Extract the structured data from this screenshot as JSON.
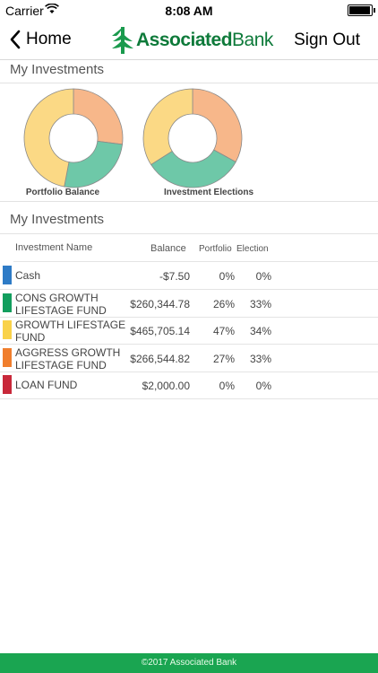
{
  "status_bar": {
    "carrier": "Carrier",
    "time": "8:08 AM",
    "battery_level": 0.95
  },
  "nav": {
    "back_label": "Home",
    "logo_text": "AssociatedBank",
    "logo_bold": "Associated",
    "logo_regular": "Bank",
    "sign_out_label": "Sign Out"
  },
  "section1_title": "My Investments",
  "section2_title": "My Investments",
  "charts": {
    "portfolio": {
      "label": "Portfolio Balance"
    },
    "elections": {
      "label": "Investment Elections"
    }
  },
  "colors": {
    "cash": "#2e7bc6",
    "cons": "#129e5e",
    "growth": "#f9d24a",
    "aggress": "#f07e2d",
    "loan": "#c8283a",
    "donut_orange": "#f7b78a",
    "donut_green": "#6ec8a8",
    "donut_yellow": "#fbd985",
    "footer_green": "#1aa551"
  },
  "table": {
    "headers": {
      "name": "Investment Name",
      "balance": "Balance",
      "portfolio": "Portfolio",
      "election": "Election"
    },
    "rows": [
      {
        "key": "cash",
        "line1": "Cash",
        "line2": "",
        "balance": "-$7.50",
        "portfolio": "0%",
        "election": "0%"
      },
      {
        "key": "cons",
        "line1": "CONS GROWTH",
        "line2": "LIFESTAGE FUND",
        "balance": "$260,344.78",
        "portfolio": "26%",
        "election": "33%"
      },
      {
        "key": "growth",
        "line1": "GROWTH LIFESTAGE",
        "line2": "FUND",
        "balance": "$465,705.14",
        "portfolio": "47%",
        "election": "34%"
      },
      {
        "key": "aggress",
        "line1": "AGGRESS GROWTH",
        "line2": "LIFESTAGE FUND",
        "balance": "$266,544.82",
        "portfolio": "27%",
        "election": "33%"
      },
      {
        "key": "loan",
        "line1": "LOAN FUND",
        "line2": "",
        "balance": "$2,000.00",
        "portfolio": "0%",
        "election": "0%"
      }
    ]
  },
  "chart_data": [
    {
      "type": "pie",
      "title": "Portfolio Balance",
      "categories": [
        "Cash",
        "CONS GROWTH LIFESTAGE FUND",
        "GROWTH LIFESTAGE FUND",
        "AGGRESS GROWTH LIFESTAGE FUND",
        "LOAN FUND"
      ],
      "values": [
        0,
        26,
        47,
        27,
        0
      ],
      "donut": true
    },
    {
      "type": "pie",
      "title": "Investment Elections",
      "categories": [
        "Cash",
        "CONS GROWTH LIFESTAGE FUND",
        "GROWTH LIFESTAGE FUND",
        "AGGRESS GROWTH LIFESTAGE FUND",
        "LOAN FUND"
      ],
      "values": [
        0,
        33,
        34,
        33,
        0
      ],
      "donut": true
    }
  ],
  "footer": "©2017 Associated Bank"
}
